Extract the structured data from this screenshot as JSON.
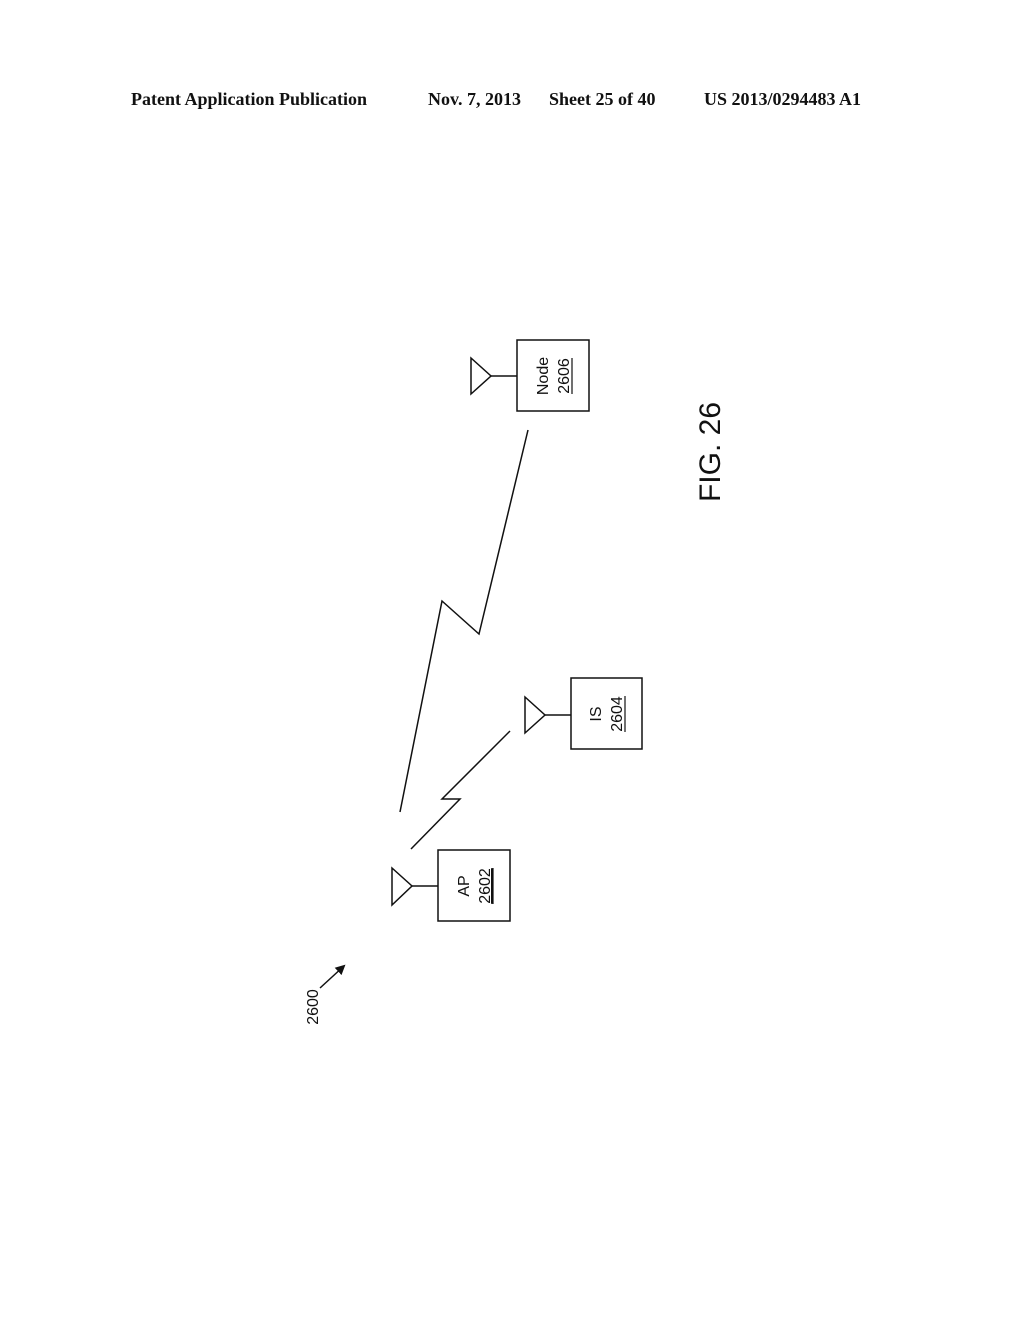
{
  "header": {
    "publication": "Patent Application Publication",
    "date": "Nov. 7, 2013",
    "sheet": "Sheet 25 of 40",
    "patent_number": "US 2013/0294483 A1"
  },
  "figure": {
    "label": "FIG. 26",
    "reference": "2600",
    "nodes": [
      {
        "id": "ap",
        "name": "AP",
        "number": "2602"
      },
      {
        "id": "is",
        "name": "IS",
        "number": "2604"
      },
      {
        "id": "node",
        "name": "Node",
        "number": "2606"
      }
    ],
    "links": [
      {
        "from": "AP 2602",
        "to": "Node 2606",
        "type": "wireless"
      },
      {
        "from": "AP 2602",
        "to": "IS 2604",
        "type": "wireless"
      }
    ]
  }
}
